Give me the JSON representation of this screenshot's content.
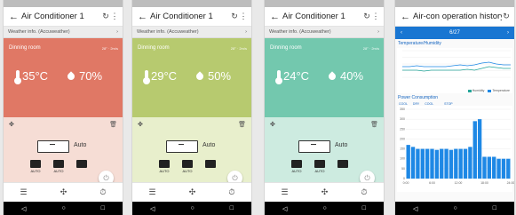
{
  "nav": {
    "back": "◁",
    "home": "○",
    "recent": "□"
  },
  "phones": [
    {
      "title": "Air Conditioner 1",
      "weather": "Weather info. (Accuweather)",
      "room": "Dinning room",
      "meta": "28° · 2m/s",
      "temp": "35°C",
      "hum": "70%",
      "mode": "Auto",
      "bg": "#e07865",
      "ctrl_bg": "#f6ddd5"
    },
    {
      "title": "Air Conditioner 1",
      "weather": "Weather info. (Accuweather)",
      "room": "Dinning room",
      "meta": "28° · 2m/s",
      "temp": "29°C",
      "hum": "50%",
      "mode": "Auto",
      "bg": "#b7ca6f",
      "ctrl_bg": "#e8efcc"
    },
    {
      "title": "Air Conditioner 1",
      "weather": "Weather info. (Accuweather)",
      "room": "Dinning room",
      "meta": "28° · 2m/s",
      "temp": "24°C",
      "hum": "40%",
      "mode": "Auto",
      "bg": "#73c8ae",
      "ctrl_bg": "#cdebe0"
    }
  ],
  "history": {
    "title": "Air-con operation history",
    "nav_label": "6/27",
    "section1": "Temperature/Humidity",
    "legend_humidity": "Humidity",
    "legend_temp": "Temperature",
    "section2": "Power Consumption",
    "mode_tabs": [
      "COOL",
      "DRY",
      "COOL",
      "",
      "STOP"
    ],
    "x_labels": [
      "0:00",
      "6:00",
      "12:00",
      "18:00",
      "24:00"
    ],
    "y_labels": [
      "350",
      "300",
      "250",
      "200",
      "150",
      "100",
      "50",
      "0"
    ],
    "temp_series": [
      22,
      22,
      23,
      22,
      22,
      22,
      22,
      23,
      24,
      23,
      24,
      26,
      27,
      25,
      24,
      24
    ],
    "hum_series": [
      18,
      18,
      18,
      17,
      18,
      18,
      18,
      18,
      18,
      19,
      18,
      20,
      22,
      21,
      20,
      20
    ],
    "bars": [
      170,
      160,
      150,
      150,
      150,
      150,
      145,
      150,
      150,
      145,
      150,
      150,
      150,
      160,
      290,
      300,
      110,
      110,
      110,
      100,
      100,
      100
    ],
    "colors": {
      "accent": "#1976d2",
      "temp": "#1e88e5",
      "hum": "#26a69a",
      "bar": "#1e88e5"
    }
  },
  "labels": {
    "auto": "AUTO"
  }
}
